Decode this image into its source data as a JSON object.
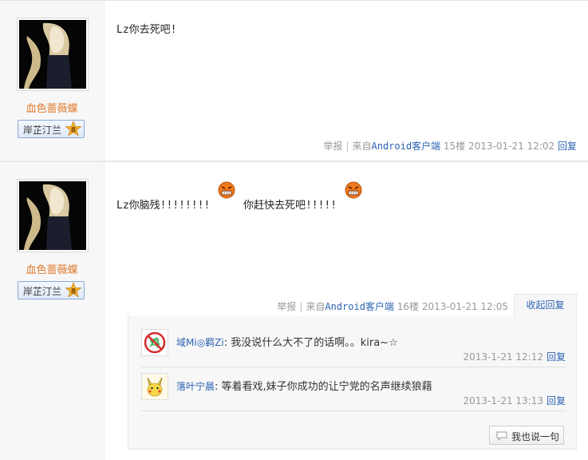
{
  "posts": [
    {
      "username": "血色蔷薇蝶",
      "badge": {
        "label": "岸芷汀兰",
        "level": "8"
      },
      "content": "Lz你去死吧!",
      "footer": {
        "report": "举报",
        "source_prefix": "来自",
        "source": "Android客户端",
        "floor": "15楼",
        "time": "2013-01-21 12:02",
        "reply": "回复"
      }
    },
    {
      "username": "血色蔷薇蝶",
      "badge": {
        "label": "岸芷汀兰",
        "level": "8"
      },
      "content_part1": "Lz你脑残!!!!!!!!",
      "content_part2": "你赶快去死吧!!!!!",
      "footer": {
        "report": "举报",
        "source_prefix": "来自",
        "source": "Android客户端",
        "floor": "16楼",
        "time": "2013-01-21 12:05",
        "collapse": "收起回复"
      },
      "replies": [
        {
          "name": "域Mi◎羁Zi",
          "text": "我没说什么大不了的话啊。。kira~☆",
          "time": "2013-1-21 12:12",
          "reply": "回复"
        },
        {
          "name": "落叶宁晨",
          "text": "等着看戏,妹子你成功的让宁党的名声继续狼藉",
          "time": "2013-1-21 13:13",
          "reply": "回复"
        }
      ],
      "say_button": "我也说一句"
    }
  ],
  "colors": {
    "link": "#2d64b3",
    "username": "#e07a2c",
    "meta": "#999999"
  }
}
